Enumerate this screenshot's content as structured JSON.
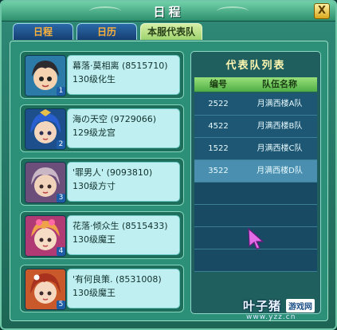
{
  "window": {
    "title": "日程",
    "close_label": "X"
  },
  "tabs": [
    {
      "label": "日程",
      "active": false
    },
    {
      "label": "日历",
      "active": false
    },
    {
      "label": "本服代表队",
      "active": true
    }
  ],
  "members": [
    {
      "name": "幕落·莫相离",
      "id": "(8515710)",
      "level": "130级化生",
      "slot": "1"
    },
    {
      "name": "海の天空",
      "id": "(9729066)",
      "level": "129级龙宫",
      "slot": "2"
    },
    {
      "name": "'罪男人'",
      "id": "(9093810)",
      "level": "130级方寸",
      "slot": "3"
    },
    {
      "name": "花落·倾众生",
      "id": "(8515433)",
      "level": "130级魔王",
      "slot": "4"
    },
    {
      "name": "'有何良策.",
      "id": "(8531008)",
      "level": "130级魔王",
      "slot": "5"
    }
  ],
  "team_list": {
    "title": "代表队列表",
    "headers": [
      "编号",
      "队伍名称"
    ],
    "rows": [
      {
        "number": "2522",
        "name": "月满西楼A队",
        "selected": false
      },
      {
        "number": "4522",
        "name": "月满西楼B队",
        "selected": false
      },
      {
        "number": "1522",
        "name": "月满西楼C队",
        "selected": false
      },
      {
        "number": "3522",
        "name": "月满西楼D队",
        "selected": true
      }
    ],
    "empty_rows": 4
  },
  "watermark": {
    "brand": "叶子猪",
    "tag": "游戏网",
    "url": "www.yzz.cn"
  }
}
